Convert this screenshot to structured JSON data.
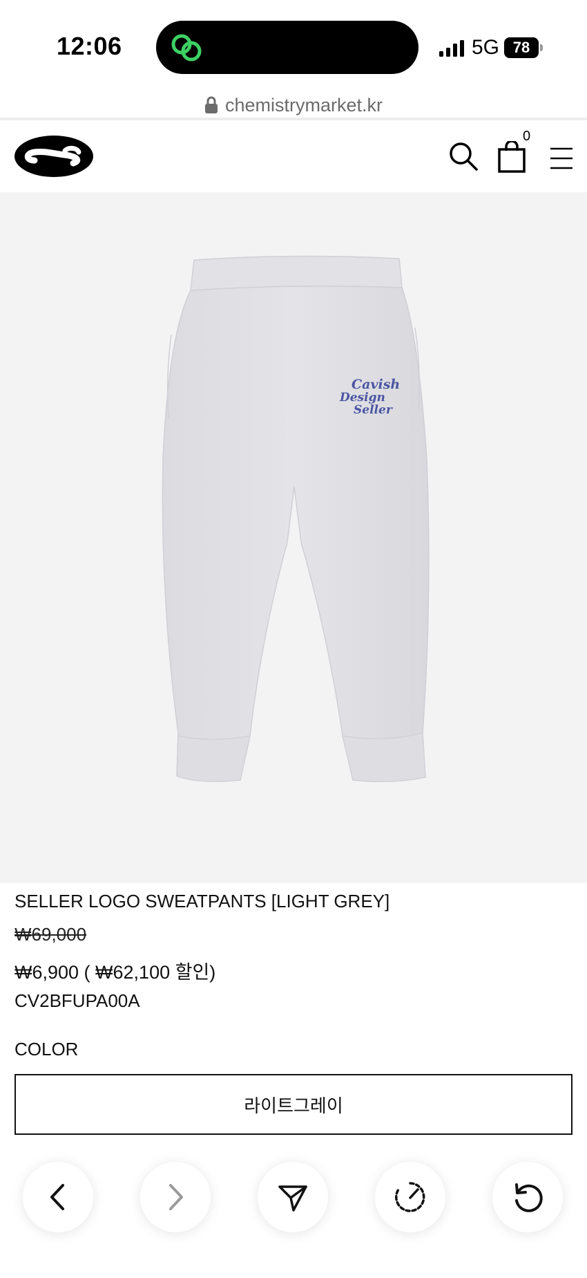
{
  "status_bar": {
    "time": "12:06",
    "network": "5G",
    "battery": "78"
  },
  "browser": {
    "url": "chemistrymarket.kr"
  },
  "header": {
    "cart_count": "0"
  },
  "product": {
    "name": "SELLER LOGO SWEATPANTS [LIGHT GREY]",
    "price_original": "₩69,000",
    "price_sale": "₩6,900 ( ₩62,100 할인)",
    "code": "CV2BFUPA00A",
    "print_text": [
      "Cavish",
      "Design",
      "Seller"
    ]
  },
  "options": {
    "color_label": "COLOR",
    "color_selected": "라이트그레이"
  },
  "toolbar": {
    "items": [
      "back",
      "forward",
      "share",
      "speed",
      "reload"
    ]
  },
  "colors": {
    "accent_green": "#3dd163",
    "print_blue": "#4a55a2",
    "image_background": "#f3f3f4"
  }
}
